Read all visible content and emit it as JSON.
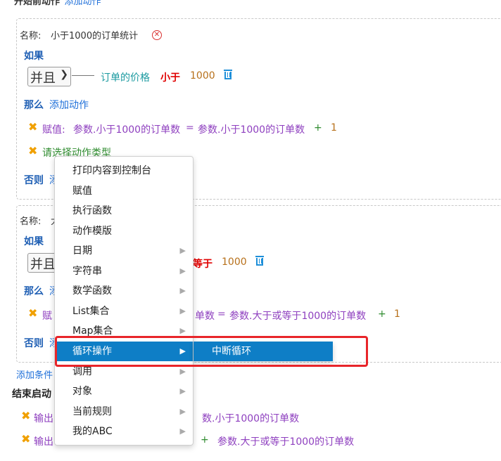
{
  "top_header": {
    "title": "开始前动作",
    "add_action": "添加动作"
  },
  "rule1": {
    "name_label": "名称:",
    "name_value": "小于1000的订单统计",
    "if_label": "如果",
    "join_value": "并且",
    "cond_field": "订单的价格",
    "cond_op": "小于",
    "cond_value": "1000",
    "then_label": "那么",
    "add_action": "添加动作",
    "action1": {
      "kind": "赋值:",
      "target": "参数.小于1000的订单数",
      "eq": "=",
      "source": "参数.小于1000的订单数",
      "plus": "+",
      "amount": "1"
    },
    "action2": {
      "placeholder": "请选择动作类型"
    },
    "else_label": "否则",
    "else_add": "添"
  },
  "rule2": {
    "name_label": "名称:",
    "name_partial": "大",
    "if_label": "如果",
    "join_value": "并且",
    "cond_op_partial": "等于",
    "cond_value": "1000",
    "then_label": "那么",
    "add_partial": "添",
    "action1": {
      "kind_partial": "赋",
      "target_partial": "单数",
      "eq": "=",
      "source": "参数.大于或等于1000的订单数",
      "plus": "+",
      "amount": "1"
    },
    "else_label": "否则",
    "else_add": "添"
  },
  "add_condition": "添加条件",
  "end_section": {
    "title_partial": "结束启动",
    "out1": {
      "kind_partial": "输出",
      "value_partial": "数.小于1000的订单数"
    },
    "out2": {
      "kind_partial": "输出",
      "plus": "+",
      "value": "参数.大于或等于1000的订单数"
    }
  },
  "context_menu": {
    "items": [
      {
        "label": "打印内容到控制台",
        "has_sub": false
      },
      {
        "label": "赋值",
        "has_sub": false
      },
      {
        "label": "执行函数",
        "has_sub": false
      },
      {
        "label": "动作模版",
        "has_sub": false
      },
      {
        "label": "日期",
        "has_sub": true
      },
      {
        "label": "字符串",
        "has_sub": true
      },
      {
        "label": "数学函数",
        "has_sub": true
      },
      {
        "label": "List集合",
        "has_sub": true
      },
      {
        "label": "Map集合",
        "has_sub": true
      },
      {
        "label": "循环操作",
        "has_sub": true,
        "active": true
      },
      {
        "label": "调用",
        "has_sub": true
      },
      {
        "label": "对象",
        "has_sub": true
      },
      {
        "label": "当前规则",
        "has_sub": true
      },
      {
        "label": "我的ABC",
        "has_sub": true
      }
    ],
    "submenu": {
      "items": [
        {
          "label": "中断循环"
        }
      ]
    }
  },
  "colors": {
    "accent": "#0e7ec6",
    "highlight": "#e8252a",
    "link": "#1e6fd9",
    "warn": "#f0a000"
  }
}
